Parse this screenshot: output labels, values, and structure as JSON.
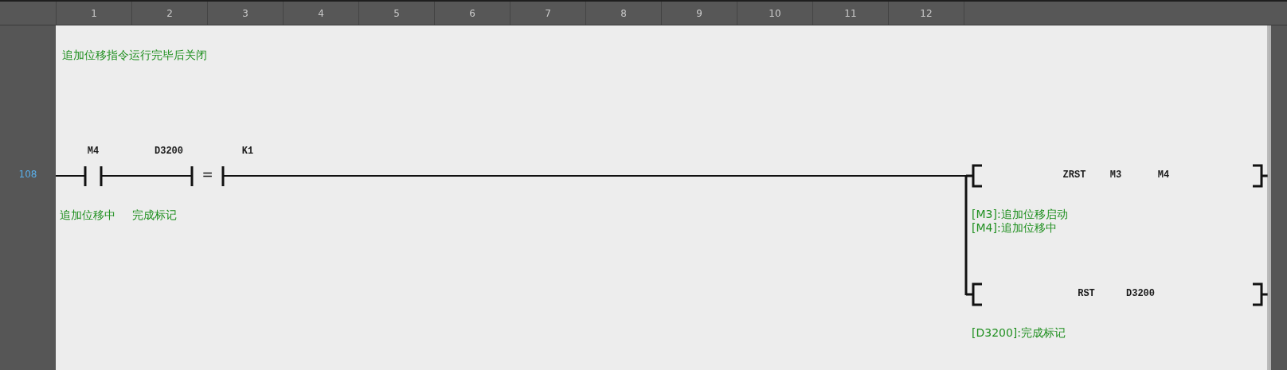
{
  "column_numbers": [
    "1",
    "2",
    "3",
    "4",
    "5",
    "6",
    "7",
    "8",
    "9",
    "10",
    "11",
    "12"
  ],
  "rungs": [
    {
      "step": "108",
      "comment": "追加位移指令运行完毕后关闭",
      "contacts": [
        {
          "kind": "no_contact",
          "device": "M4",
          "comment": "追加位移中"
        },
        {
          "kind": "compare",
          "operand1": "D3200",
          "operator": "=",
          "operand2": "K1",
          "comment": "完成标记"
        }
      ],
      "outputs": [
        {
          "instruction": "ZRST",
          "operands": [
            "M3",
            "M4"
          ],
          "comments": [
            "[M3]:追加位移启动",
            "[M4]:追加位移中"
          ]
        },
        {
          "instruction": "RST",
          "operands": [
            "D3200"
          ],
          "comments": [
            "[D3200]:完成标记"
          ]
        }
      ]
    }
  ]
}
